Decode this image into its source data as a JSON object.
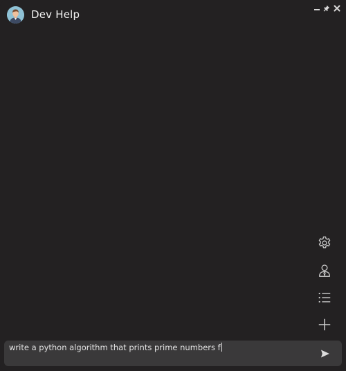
{
  "app": {
    "title": "Dev Help"
  },
  "icons": {
    "avatar": "person-avatar",
    "minimize": "minimize-icon",
    "pin": "pin-icon",
    "close": "close-icon",
    "settings": "gear-icon",
    "persona": "person-icon",
    "history": "list-icon",
    "new_chat": "plus-icon",
    "send": "send-icon"
  },
  "input": {
    "value": "write a python algorithm that prints prime numbers f"
  },
  "colors": {
    "background": "#232122",
    "input_background": "#3a393a",
    "icon": "#cfcfcf"
  }
}
